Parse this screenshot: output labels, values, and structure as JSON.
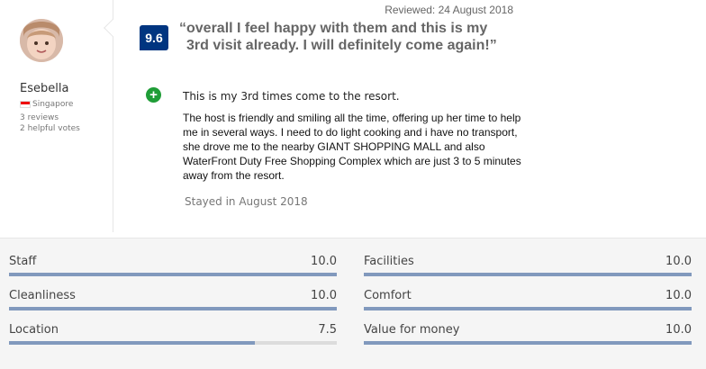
{
  "reviewer": {
    "name": "Esebella",
    "country": "Singapore",
    "reviews": "3 reviews",
    "helpful_votes": "2 helpful votes"
  },
  "review": {
    "reviewed_date": "Reviewed: 24 August 2018",
    "score": "9.6",
    "headline_line1": "“overall I feel happy with them and this is my",
    "headline_line2": "3rd visit already. I will definitely come again!”",
    "positive_title": "This is my 3rd times come to the resort.",
    "positive_body": "The host is friendly and smiling all the time, offering up her time to help me in several ways.  I need to do light cooking and i have no transport, she drove me to the nearby GIANT SHOPPING MALL and also WaterFront Duty Free Shopping Complex which are just 3 to 5 minutes away from the resort.",
    "stayed": "Stayed in August 2018"
  },
  "category_scores": [
    {
      "label": "Staff",
      "value": "10.0",
      "fraction": 1.0
    },
    {
      "label": "Facilities",
      "value": "10.0",
      "fraction": 1.0
    },
    {
      "label": "Cleanliness",
      "value": "10.0",
      "fraction": 1.0
    },
    {
      "label": "Comfort",
      "value": "10.0",
      "fraction": 1.0
    },
    {
      "label": "Location",
      "value": "7.5",
      "fraction": 0.75
    },
    {
      "label": "Value for money",
      "value": "10.0",
      "fraction": 1.0
    }
  ],
  "colors": {
    "score_badge": "#003580",
    "positive_icon": "#1f9d37",
    "bar_fill": "#8199bd",
    "bar_track": "#dcdcdc"
  },
  "icons": {
    "positive": "plus-circle-icon",
    "flag": "singapore-flag-icon"
  }
}
